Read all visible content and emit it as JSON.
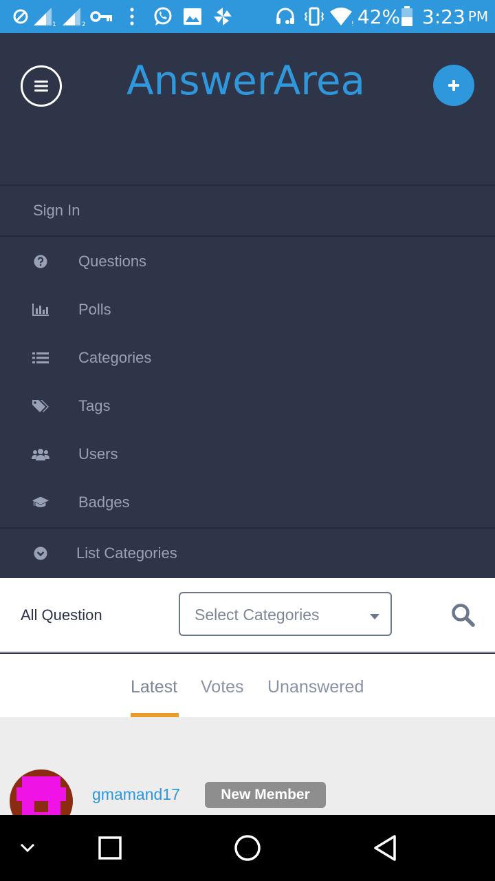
{
  "status_bar": {
    "battery": "42%",
    "time": "3:23",
    "ampm": "PM",
    "icons": [
      "dnd-icon",
      "signal-sim1-icon",
      "signal-sim2-icon",
      "vpn-key-icon",
      "more-vert-icon",
      "whatsapp-icon",
      "image-icon",
      "pinwheel-icon",
      "headset-icon",
      "vibrate-icon",
      "wifi-icon",
      "battery-icon"
    ]
  },
  "header": {
    "logo": "AnswerArea",
    "accent_color": "#2f97dc"
  },
  "nav": {
    "sign_in": "Sign In",
    "items": [
      {
        "label": "Questions",
        "icon": "question-circle-icon"
      },
      {
        "label": "Polls",
        "icon": "bar-chart-icon"
      },
      {
        "label": "Categories",
        "icon": "list-icon"
      },
      {
        "label": "Tags",
        "icon": "tags-icon"
      },
      {
        "label": "Users",
        "icon": "users-icon"
      },
      {
        "label": "Badges",
        "icon": "graduation-cap-icon"
      }
    ],
    "list_categories": {
      "label": "List Categories",
      "icon": "chevron-circle-down-icon"
    }
  },
  "filter": {
    "title": "All Question",
    "select_value": "Select Categories"
  },
  "tabs": [
    {
      "label": "Latest",
      "active": true
    },
    {
      "label": "Votes",
      "active": false
    },
    {
      "label": "Unanswered",
      "active": false
    }
  ],
  "tab_accent": "#e89d2a",
  "post": {
    "username": "gmamand17",
    "badge": "New Member"
  }
}
